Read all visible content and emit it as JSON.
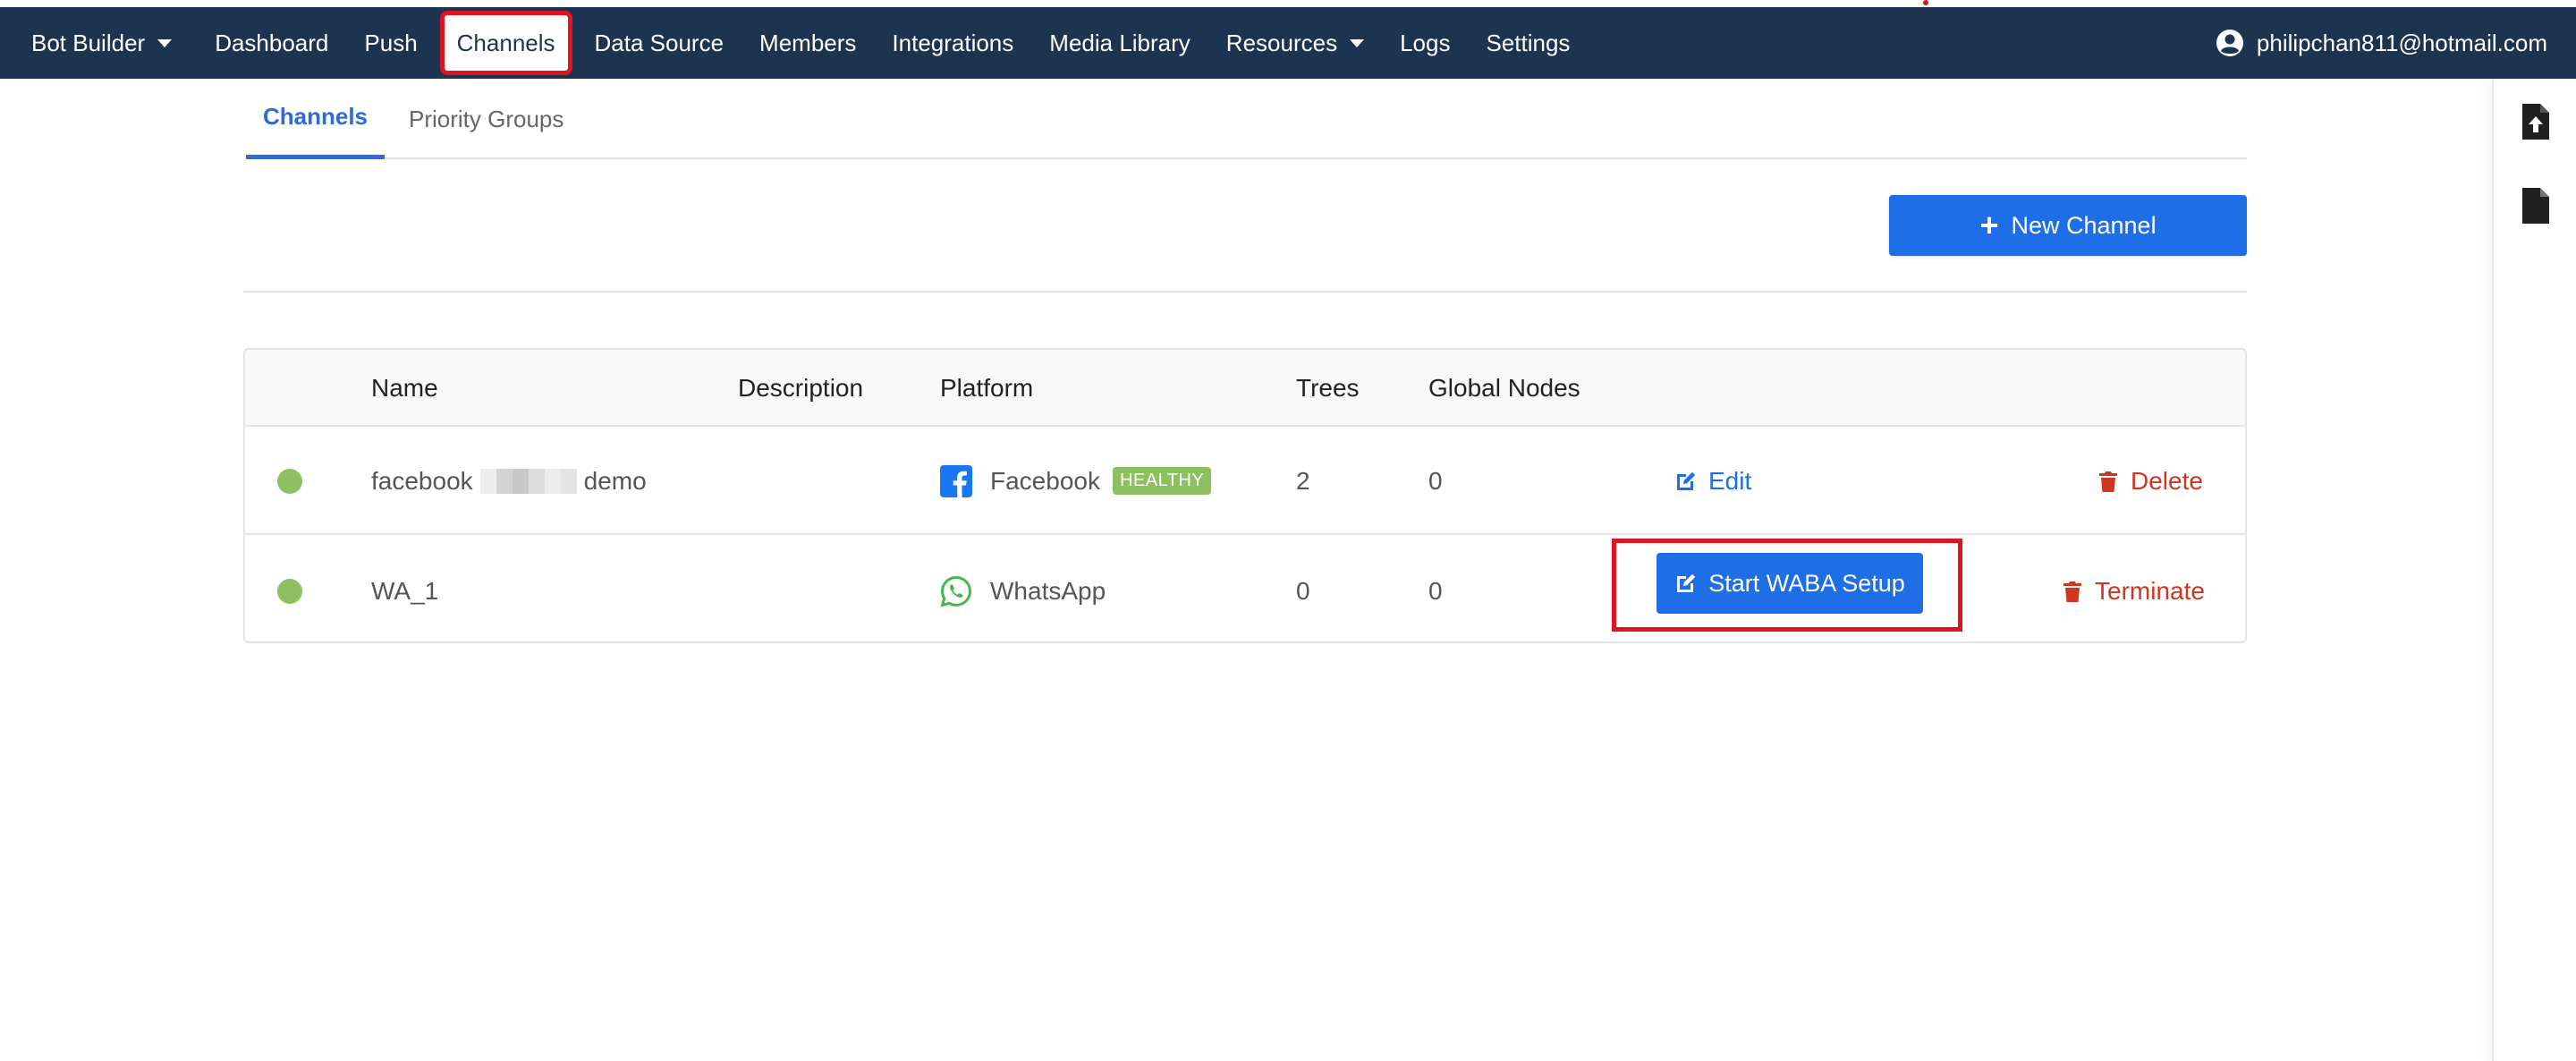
{
  "navbar": {
    "brand": "Bot Builder",
    "items": [
      "Dashboard",
      "Push",
      "Channels",
      "Data Source",
      "Members",
      "Integrations",
      "Media Library"
    ],
    "resources": "Resources",
    "logs": "Logs",
    "settings": "Settings",
    "user_email": "philipchan811@hotmail.com"
  },
  "tabs": {
    "active": "Channels",
    "inactive": "Priority Groups"
  },
  "actions": {
    "new_channel": "New Channel"
  },
  "table": {
    "headers": [
      "Name",
      "Description",
      "Platform",
      "Trees",
      "Global Nodes"
    ],
    "rows": [
      {
        "name_prefix": "facebook",
        "name_suffix": "demo",
        "description": "",
        "platform": "Facebook",
        "status_badge": "HEALTHY",
        "trees": "2",
        "global_nodes": "0",
        "primary_action": "Edit",
        "danger_action": "Delete"
      },
      {
        "name": "WA_1",
        "description": "",
        "platform": "WhatsApp",
        "trees": "0",
        "global_nodes": "0",
        "primary_action": "Start WABA Setup",
        "danger_action": "Terminate"
      }
    ]
  },
  "colors": {
    "navbar": "#1c3450",
    "primary": "#1e6ee8",
    "danger": "#d03520",
    "success": "#8cc060",
    "highlight": "#e0141e"
  },
  "icons": {
    "user": "user-circle-icon",
    "upload": "file-upload-icon",
    "file": "file-icon",
    "facebook": "facebook-icon",
    "whatsapp": "whatsapp-icon",
    "edit": "edit-icon",
    "trash": "trash-icon"
  }
}
